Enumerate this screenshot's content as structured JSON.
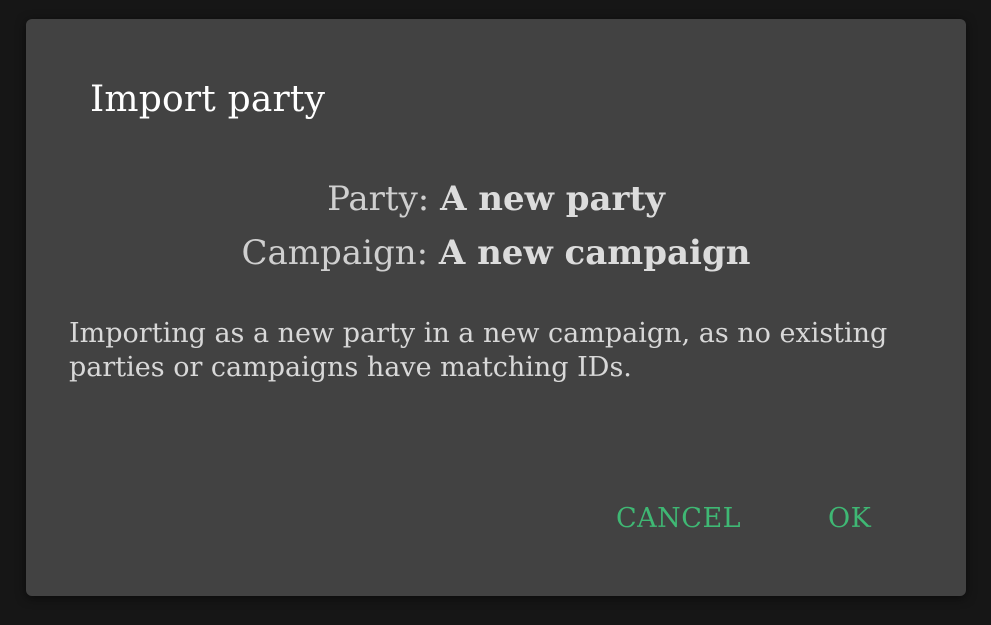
{
  "dialog": {
    "title": "Import party",
    "party_label": "Party: ",
    "party_value": "A new party",
    "campaign_label": "Campaign: ",
    "campaign_value": "A new campaign",
    "message": "Importing as a new party in a new campaign, as no existing parties or campaigns have matching IDs.",
    "cancel_label": "CANCEL",
    "ok_label": "OK"
  },
  "colors": {
    "background": "#161616",
    "dialog_background": "#424242",
    "title_text": "#ffffff",
    "body_text": "#d8d8d8",
    "button_accent": "#3fb874"
  }
}
